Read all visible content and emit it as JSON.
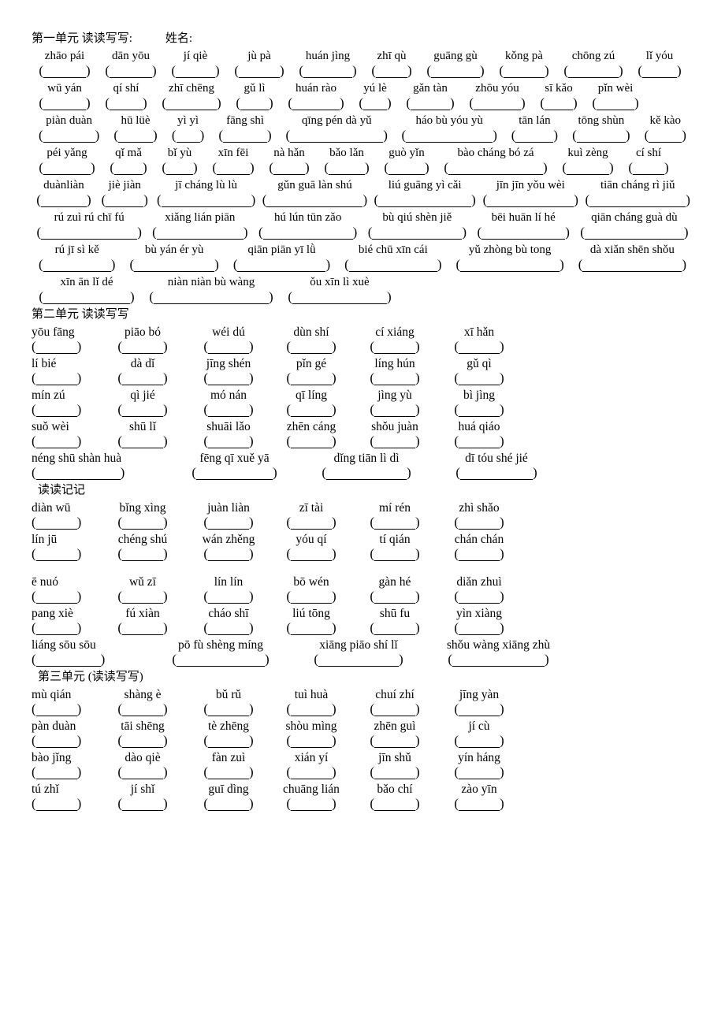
{
  "document": {
    "title_line": {
      "unit": "第一单元 读读写写:",
      "name_label": "姓名:"
    }
  },
  "sections": [
    {
      "id": "unit1",
      "heading": "第一单元 读读写写:",
      "name_label": "姓名:",
      "rows": [
        {
          "words": [
            "zhāo pái",
            "dān yōu",
            "jí qiè",
            "jù pà",
            "huán jìng",
            "zhī qù",
            "guāng gù",
            "kǒng pà",
            "chōng zú",
            "lǐ yóu"
          ],
          "widths": [
            84,
            84,
            80,
            82,
            92,
            70,
            92,
            82,
            94,
            74
          ]
        },
        {
          "words": [
            "wū yán",
            "qí shí",
            "zhī chēng",
            "gǔ lì",
            "huán rào",
            "yú lè",
            "gǎn tàn",
            "zhōu yóu",
            "sī kǎo",
            "pǐn wèi"
          ],
          "widths": [
            84,
            72,
            94,
            66,
            90,
            60,
            80,
            90,
            66,
            78
          ]
        },
        {
          "words": [
            "piàn duàn",
            "hū lüè",
            "yì yì",
            "fāng shì",
            "qīng pén dà yǔ",
            "háo bù yóu yù",
            "tān lán",
            "tōng shùn",
            "kě kào"
          ],
          "widths": [
            96,
            74,
            60,
            86,
            148,
            140,
            78,
            92,
            72
          ]
        },
        {
          "words": [
            "péi yǎng",
            "qǐ mǎ",
            "bǐ yù",
            "xīn fēi",
            "nà hǎn",
            "bǎo lǎn",
            "guò yǐn",
            "bào cháng bó zá",
            "kuì zèng",
            "cí shí"
          ],
          "widths": [
            90,
            66,
            64,
            72,
            70,
            76,
            76,
            150,
            84,
            70
          ]
        },
        {
          "words": [
            "duànliàn",
            "jiè jiàn",
            "jī cháng lù lù",
            "gǔn guā làn shú",
            "liú guāng yì cǎi",
            "jīn jīn yǒu wèi",
            "tiān cháng rì jiǔ"
          ],
          "widths": [
            88,
            78,
            144,
            152,
            148,
            140,
            152
          ]
        },
        {
          "words": [
            "rú zuì rú chī fú",
            "xiǎng lián piān",
            "hú lún tūn zǎo",
            "bù qiú shèn jiě",
            "bēi huān lí hé",
            "qiān cháng guà dù"
          ],
          "widths": [
            152,
            140,
            144,
            144,
            136,
            156
          ]
        },
        {
          "words": [
            "rú jī sì kě",
            "bù yán ér yù",
            "qiān piān yī lǜ",
            "bié chū xīn cái",
            "yǔ zhòng bù tong",
            "dà xiǎn shēn shǒu"
          ],
          "widths": [
            116,
            132,
            142,
            142,
            156,
            156
          ]
        },
        {
          "words": [
            "xīn ān lǐ dé",
            "niàn niàn bù wàng",
            "ǒu xīn lì xuè"
          ],
          "widths": [
            140,
            176,
            150
          ]
        }
      ]
    },
    {
      "id": "unit2",
      "heading": "第二单元 读读写写",
      "columns": 6,
      "rows": [
        [
          "yōu fāng",
          "piāo bó",
          "wéi dú",
          "dùn shí",
          "cí xiáng",
          "xī hǎn"
        ],
        [
          "lí bié",
          "dà dǐ",
          "jīng shén",
          "pǐn gé",
          "líng hún",
          "gǔ qì"
        ],
        [
          "mín zú",
          "qì jié",
          "mó nán",
          "qī líng",
          "jìng yù",
          "bì jìng"
        ],
        [
          "suǒ wèi",
          "shū lǐ",
          "shuāi lǎo",
          "zhēn cáng",
          "shǒu juàn",
          "huá qiáo"
        ]
      ],
      "long_row": {
        "words": [
          "néng shū shàn huà",
          "fēng qī xuě yā",
          "dǐng tiān lì dì",
          "dī tóu shé jié"
        ],
        "widths": [
          175,
          165,
          170,
          160
        ]
      }
    },
    {
      "id": "dudujiji",
      "heading": "读读记记",
      "columns": 6,
      "rows": [
        [
          "diàn wū",
          "bǐng xìng",
          "juàn liàn",
          "zī tài",
          "mí rén",
          "zhì shǎo"
        ],
        [
          "lín jū",
          "chéng shú",
          "wán zhěng",
          "yóu qí",
          "tí qián",
          "chán chán"
        ]
      ],
      "rows2": [
        [
          "ē nuó",
          "wǔ zī",
          "lín lín",
          "bō wén",
          "gàn hé",
          "diǎn zhuì"
        ],
        [
          "pang xiè",
          "fú xiàn",
          "cháo shī",
          "liú tōng",
          "shū fu",
          "yìn xiàng"
        ]
      ],
      "long_row": {
        "words": [
          "liáng sōu sōu",
          "pō fù shèng míng",
          "xiāng piāo shí lǐ",
          "shǒu wàng xiāng zhù"
        ],
        "widths": [
          150,
          180,
          170,
          185
        ]
      }
    },
    {
      "id": "unit3",
      "heading": "第三单元 (读读写写)",
      "columns": 6,
      "rows": [
        [
          "mù qián",
          "shàng è",
          "bǔ rǔ",
          "tuì huà",
          "chuí zhí",
          "jīng yàn"
        ],
        [
          "pàn duàn",
          "tāi shēng",
          "tè zhēng",
          "shòu mìng",
          "zhēn guì",
          "jí cù"
        ],
        [
          "bào jǐng",
          "dào qiè",
          "fàn zuì",
          "xián yí",
          "jīn shǔ",
          "yín háng"
        ],
        [
          "tú zhǐ",
          "jí shǐ",
          "guī dìng",
          "chuāng lián",
          "bǎo chí",
          "zào yīn"
        ]
      ]
    }
  ],
  "blank": {
    "open_paren": "(",
    "close_paren": ")"
  }
}
